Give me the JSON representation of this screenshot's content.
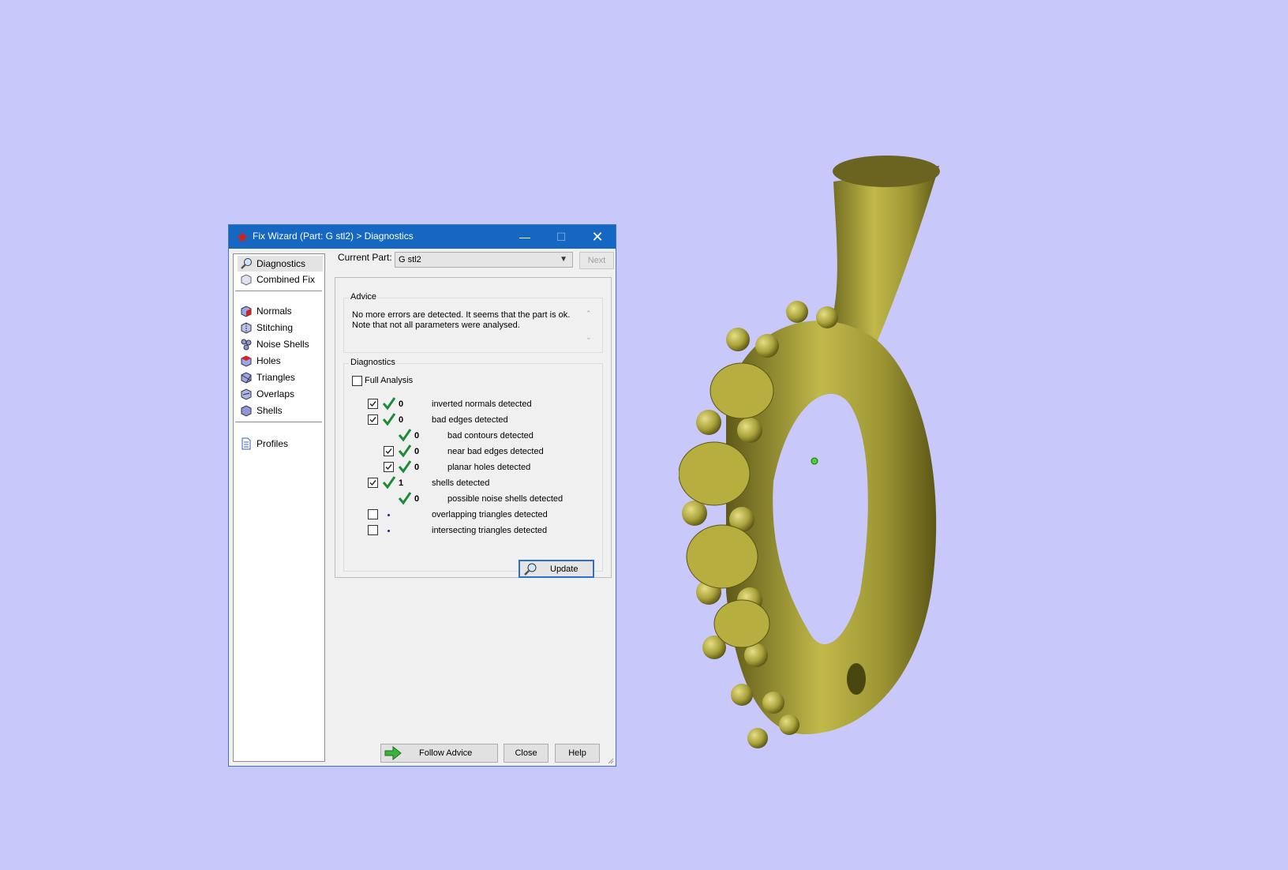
{
  "window": {
    "title": "Fix Wizard (Part: G stl2) > Diagnostics",
    "controls": {
      "minimize": "—",
      "maximize": "☐",
      "close": "✕"
    }
  },
  "nav": {
    "items": [
      {
        "label": "Diagnostics",
        "icon": "magnifier-icon"
      },
      {
        "label": "Combined Fix",
        "icon": "cube-icon"
      },
      {
        "label": "Normals",
        "icon": "normals-cube-icon"
      },
      {
        "label": "Stitching",
        "icon": "stitching-cube-icon"
      },
      {
        "label": "Noise Shells",
        "icon": "noise-shells-icon"
      },
      {
        "label": "Holes",
        "icon": "holes-cube-icon"
      },
      {
        "label": "Triangles",
        "icon": "triangles-cube-icon"
      },
      {
        "label": "Overlaps",
        "icon": "overlaps-cube-icon"
      },
      {
        "label": "Shells",
        "icon": "shells-cube-icon"
      },
      {
        "label": "Profiles",
        "icon": "document-icon"
      }
    ],
    "selected": "Diagnostics"
  },
  "current_part": {
    "label": "Current Part:",
    "value": "G stl2",
    "next_label": "Next"
  },
  "advice": {
    "legend": "Advice",
    "text_line1": "No more errors are detected. It seems that the part is ok.",
    "text_line2": "Note that not all parameters were analysed."
  },
  "diagnostics": {
    "legend": "Diagnostics",
    "full_analysis_label": "Full Analysis",
    "rows": [
      {
        "num": "0",
        "label": "inverted normals detected"
      },
      {
        "num": "0",
        "label": "bad edges detected"
      },
      {
        "num": "0",
        "label": "bad contours detected"
      },
      {
        "num": "0",
        "label": "near bad edges detected"
      },
      {
        "num": "0",
        "label": "planar holes detected"
      },
      {
        "num": "1",
        "label": "shells detected"
      },
      {
        "num": "0",
        "label": "possible noise shells detected"
      },
      {
        "num": "",
        "label": "overlapping triangles detected"
      },
      {
        "num": "",
        "label": "intersecting triangles detected"
      }
    ],
    "update_label": "Update"
  },
  "buttons": {
    "follow_advice": "Follow Advice",
    "close": "Close",
    "help": "Help"
  },
  "colors": {
    "background": "#c8c8fb",
    "titlebar": "#1567c2",
    "check_green": "#1f8a3a",
    "model_gold": "#b5ad3e"
  }
}
